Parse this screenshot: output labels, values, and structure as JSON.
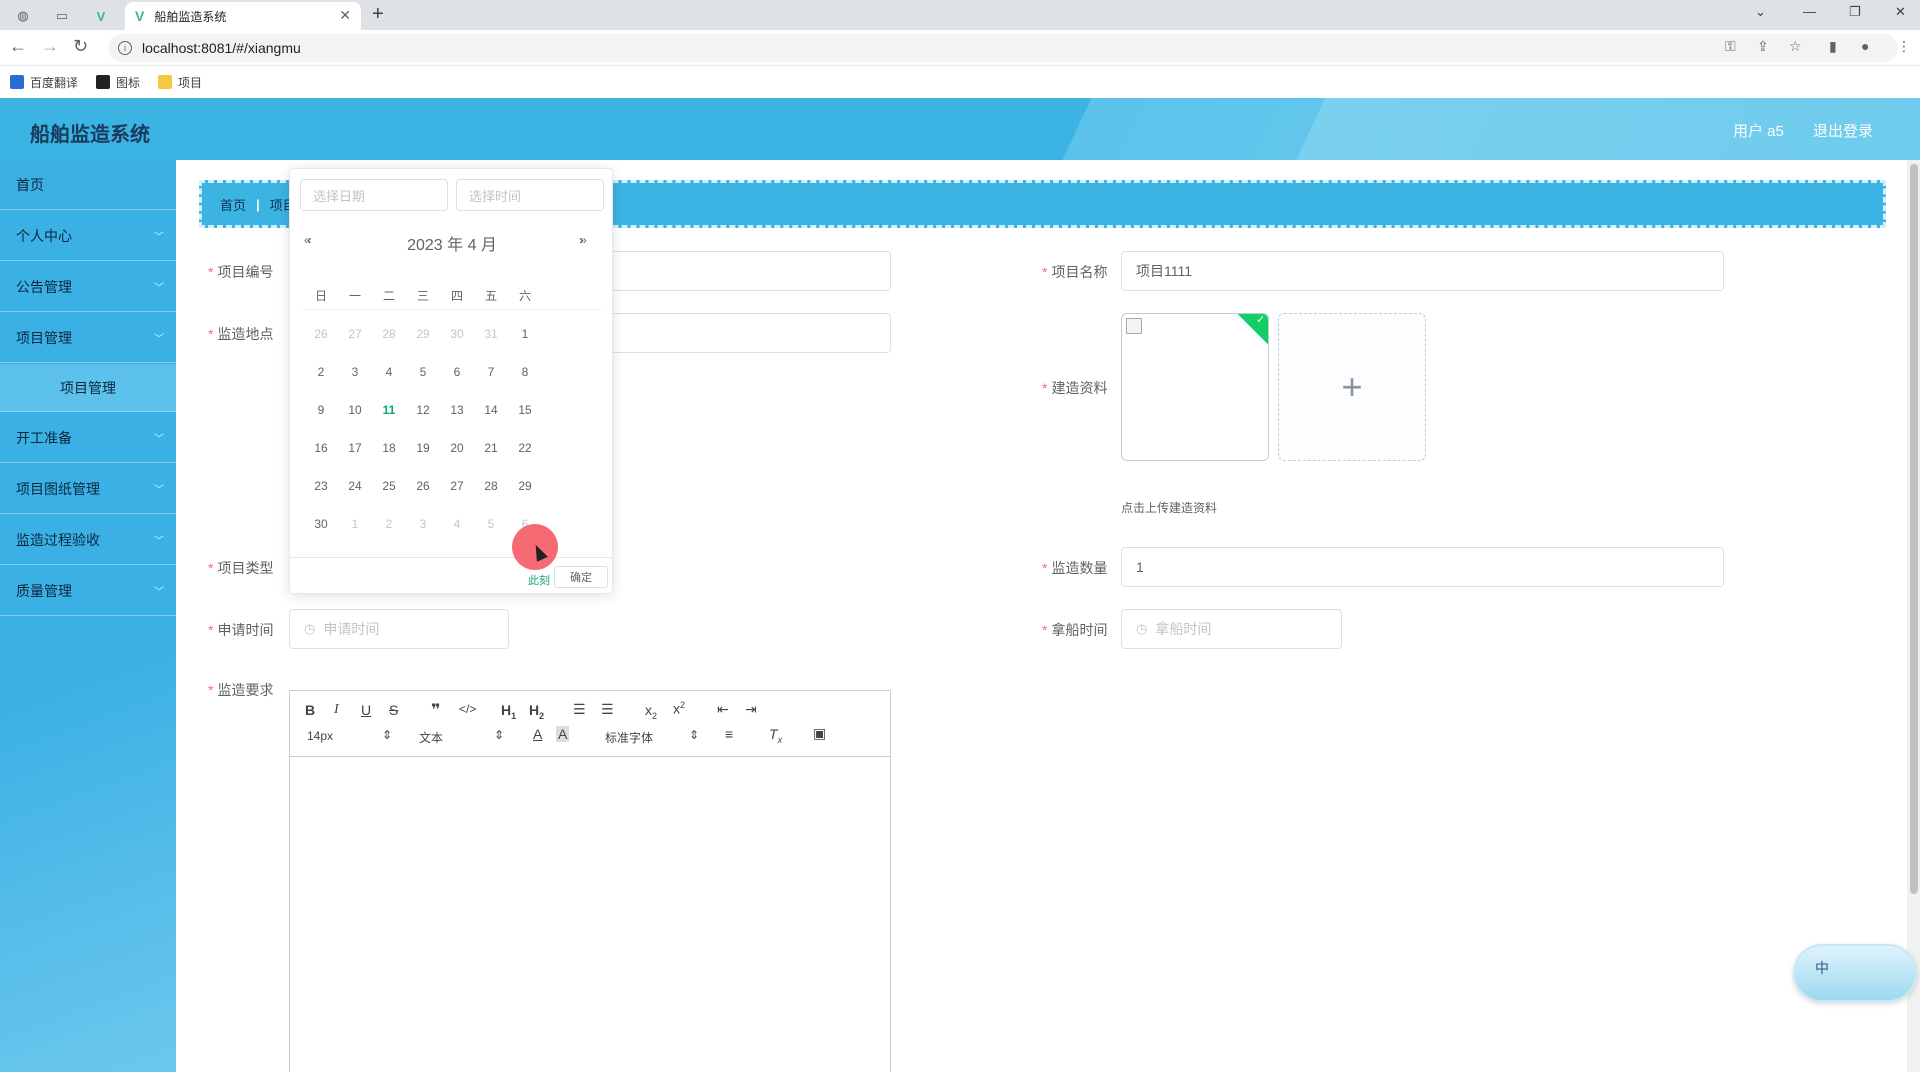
{
  "browser": {
    "tab_title": "船舶监造系统",
    "url": "localhost:8081/#/xiangmu",
    "bookmarks": [
      "百度翻译",
      "图标",
      "项目"
    ]
  },
  "header": {
    "title": "船舶监造系统",
    "user": "用户 a5",
    "logout": "退出登录"
  },
  "sidebar": {
    "items": [
      "首页",
      "个人中心",
      "公告管理",
      "项目管理",
      "开工准备",
      "项目图纸管理",
      "监造过程验收",
      "质量管理"
    ],
    "subitem": "项目管理"
  },
  "breadcrumb": {
    "home": "首页",
    "current": "项目"
  },
  "form": {
    "labels": {
      "code": "项目编号",
      "location": "监造地点",
      "type": "项目类型",
      "apply_time": "申请时间",
      "requirement": "监造要求",
      "name": "项目名称",
      "materials": "建造资料",
      "quantity": "监造数量",
      "ship_time": "拿船时间"
    },
    "values": {
      "name": "项目1111",
      "quantity": "1"
    },
    "placeholders": {
      "apply_time": "申请时间",
      "ship_time": "拿船时间"
    },
    "upload_tip": "点击上传建造资料",
    "upload_plus": "+",
    "upload_ok": "✓"
  },
  "editor": {
    "font_size": "14px",
    "block": "文本",
    "font": "标准字体"
  },
  "datepicker": {
    "date_placeholder": "选择日期",
    "time_placeholder": "选择时间",
    "header": "2023 年  4 月",
    "prev": "«‹",
    "next": "›»",
    "weekdays": [
      "日",
      "一",
      "二",
      "三",
      "四",
      "五",
      "六"
    ],
    "rows": [
      [
        "26",
        "27",
        "28",
        "29",
        "30",
        "31",
        "1"
      ],
      [
        "2",
        "3",
        "4",
        "5",
        "6",
        "7",
        "8"
      ],
      [
        "9",
        "10",
        "11",
        "12",
        "13",
        "14",
        "15"
      ],
      [
        "16",
        "17",
        "18",
        "19",
        "20",
        "21",
        "22"
      ],
      [
        "23",
        "24",
        "25",
        "26",
        "27",
        "28",
        "29"
      ],
      [
        "30",
        "1",
        "2",
        "3",
        "4",
        "5",
        "6"
      ]
    ],
    "today": "11",
    "now_btn": "此刻",
    "ok_btn": "确定"
  },
  "ime": {
    "label": "中"
  }
}
